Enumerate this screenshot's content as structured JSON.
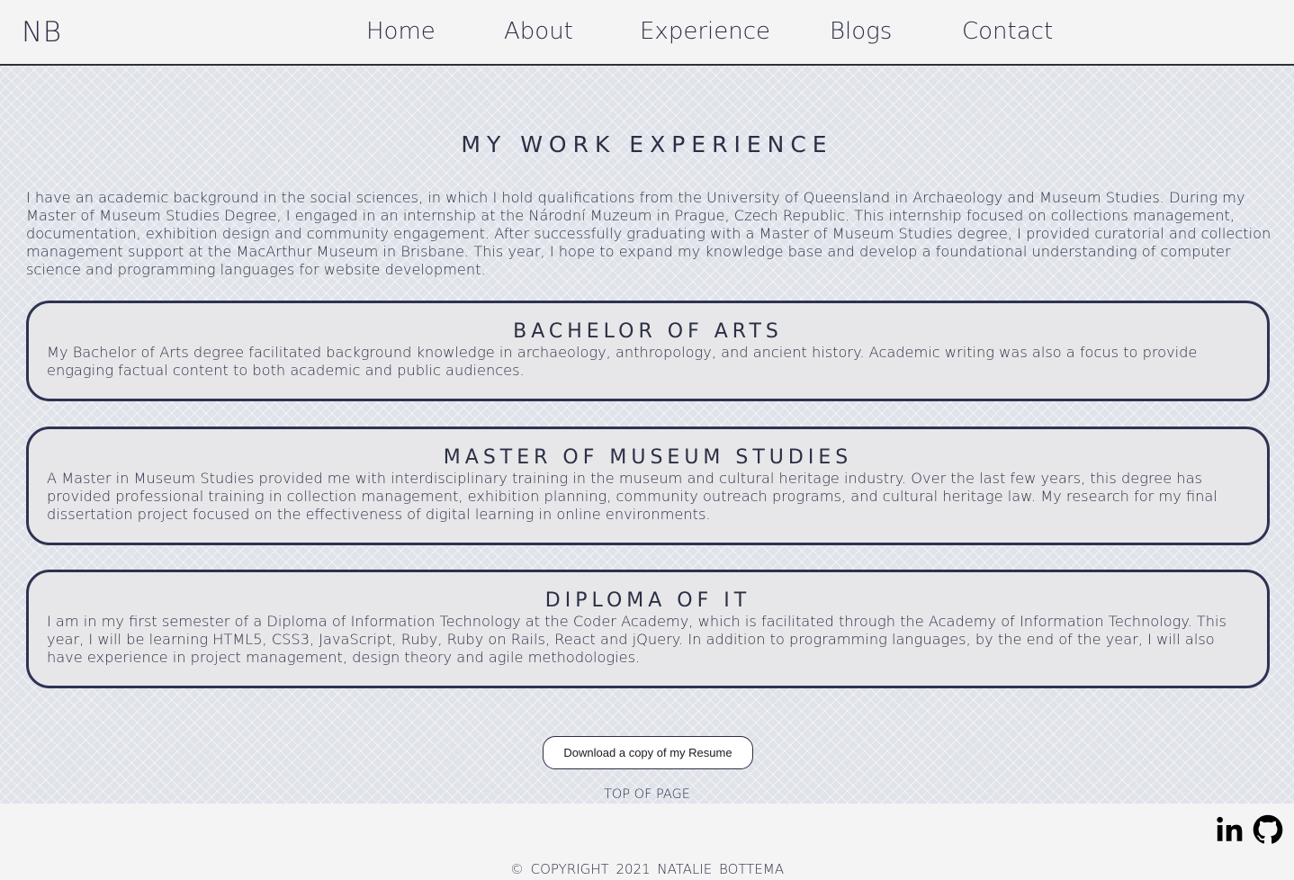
{
  "nav": {
    "logo": "NB",
    "links": [
      "Home",
      "About",
      "Experience",
      "Blogs",
      "Contact"
    ]
  },
  "main": {
    "title": "MY WORK EXPERIENCE",
    "intro": "I have an academic background in the social sciences, in which I hold qualifications from the University of Queensland in Archaeology and Museum Studies. During my Master of Museum Studies Degree, I engaged in an internship at the Národní Muzeum in Prague, Czech Republic. This internship focused on collections management, documentation, exhibition design and community engagement. After successfully graduating with a Master of Museum Studies degree, I provided curatorial and collection management support at the MacArthur Museum in Brisbane. This year, I hope to expand my knowledge base and develop a foundational understanding of computer science and programming languages for website development.",
    "cards": [
      {
        "title": "BACHELOR OF ARTS",
        "text": "My Bachelor of Arts degree facilitated background knowledge in archaeology, anthropology, and ancient history. Academic writing was also a focus to provide engaging factual content to both academic and public audiences."
      },
      {
        "title": "MASTER OF MUSEUM STUDIES",
        "text": "A Master in Museum Studies provided me with interdisciplinary training in the museum and cultural heritage industry. Over the last few years, this degree has provided professional training in collection management, exhibition planning, community outreach programs, and cultural heritage law. My research for my final dissertation project focused on the effectiveness of digital learning in online environments."
      },
      {
        "title": "DIPLOMA OF IT",
        "text": "I am in my first semester of a Diploma of Information Technology at the Coder Academy, which is facilitated through the Academy of Information Technology. This year, I will be learning HTML5, CSS3, JavaScript, Ruby, Ruby on Rails, React and jQuery. In addition to programming languages, by the end of the year, I will also have experience in project management, design theory and agile methodologies."
      }
    ],
    "resume_button": "Download a copy of my Resume",
    "top_link": "TOP OF PAGE"
  },
  "footer": {
    "icons": [
      "linkedin-icon",
      "github-icon"
    ],
    "copyright": "© COPYRIGHT 2021 NATALIE BOTTEMA"
  },
  "colors": {
    "text": "#2b2f45",
    "nav_bg": "#f4f4f4",
    "card_border": "#2f3352",
    "card_bg": "#e7e7e9",
    "page_bg": "#e0e3e9"
  }
}
